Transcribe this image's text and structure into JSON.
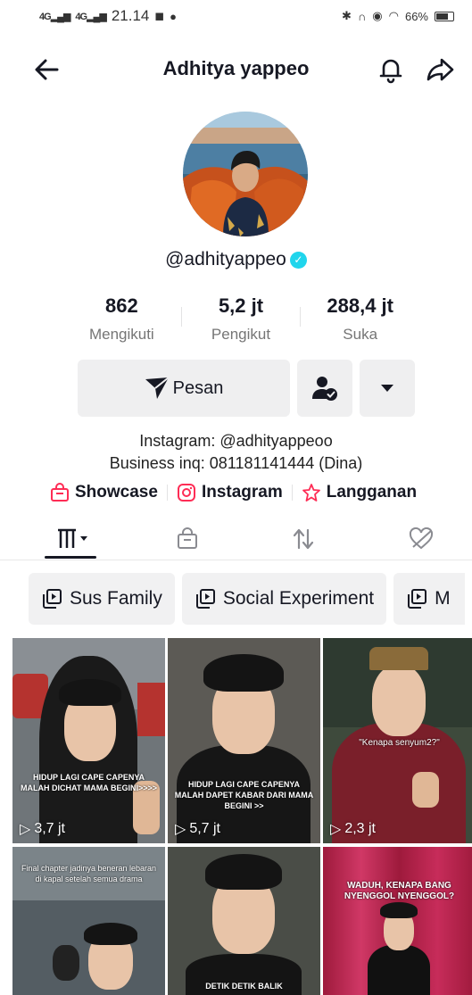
{
  "status_bar": {
    "signal1": "4G",
    "signal2": "4G",
    "time": "21.14",
    "battery": "66%"
  },
  "header": {
    "title": "Adhitya yappeo"
  },
  "profile": {
    "username": "@adhityappeo"
  },
  "stats": [
    {
      "value": "862",
      "label": "Mengikuti"
    },
    {
      "value": "5,2 jt",
      "label": "Pengikut"
    },
    {
      "value": "288,4 jt",
      "label": "Suka"
    }
  ],
  "actions": {
    "message_label": "Pesan"
  },
  "bio": {
    "line1": "Instagram: @adhityappeoo",
    "line2": "Business inq: 081181141444 (Dina)"
  },
  "links": {
    "showcase": "Showcase",
    "instagram": "Instagram",
    "subscription": "Langganan"
  },
  "playlists": [
    "Sus Family",
    "Social Experiment",
    "M"
  ],
  "videos": [
    {
      "caption": "HIDUP LAGI CAPE CAPENYA MALAH DICHAT MAMA BEGINI>>>>",
      "views": "3,7 jt"
    },
    {
      "caption": "HIDUP LAGI CAPE CAPENYA MALAH DAPET KABAR DARI MAMA BEGINI >>",
      "views": "5,7 jt"
    },
    {
      "caption": "\"Kenapa senyum2?\"",
      "views": "2,3 jt"
    },
    {
      "caption": "Final chapter jadinya beneran lebaran di kapal setelah semua drama",
      "views": ""
    },
    {
      "caption": "DETIK DETIK BALIK",
      "views": ""
    },
    {
      "caption": "WADUH, KENAPA BANG NYENGGOL NYENGGOL?",
      "views": ""
    }
  ],
  "colors": {
    "accent_pink": "#fe2c55",
    "verified": "#20d5ec"
  }
}
